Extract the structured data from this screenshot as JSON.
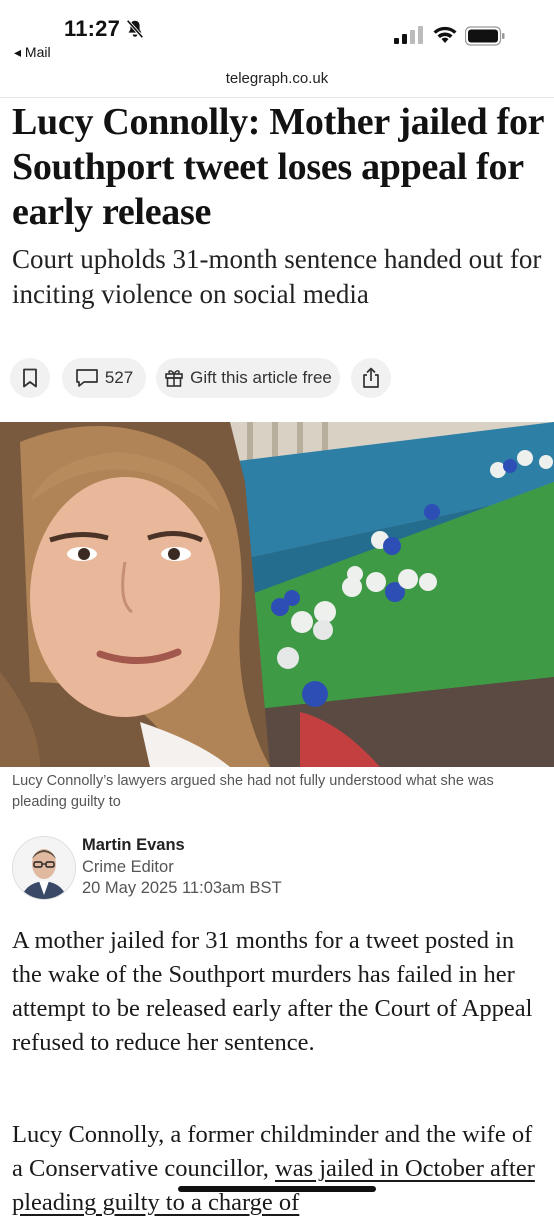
{
  "status_bar": {
    "time": "11:27",
    "back_app": "◂ Mail"
  },
  "browser": {
    "url": "telegraph.co.uk"
  },
  "article": {
    "headline": "Lucy Connolly: Mother jailed for Southport tweet loses appeal for early release",
    "standfirst": "Court upholds 31-month sentence handed out for inciting violence on social media",
    "actions": {
      "comments_count": "527",
      "gift_label": "Gift this article free"
    },
    "image_caption": "Lucy Connolly’s lawyers argued she had not fully understood what she was pleading guilty to",
    "author": {
      "name": "Martin Evans",
      "role": "Crime Editor",
      "date": "20 May 2025 11:03am BST"
    },
    "body": {
      "p1": "A mother jailed for 31 months for a tweet posted in the wake of the Southport murders has failed in her attempt to be released early after the Court of Appeal refused to reduce her sentence.",
      "p2_start": "Lucy Connolly, a former childminder and the wife of a Conservative councillor, ",
      "p2_link": "was jailed in October after pleading guilty to a charge of"
    }
  },
  "colors": {
    "headline": "#121212",
    "pill_bg": "#f1f1f1",
    "caption": "#555555"
  }
}
